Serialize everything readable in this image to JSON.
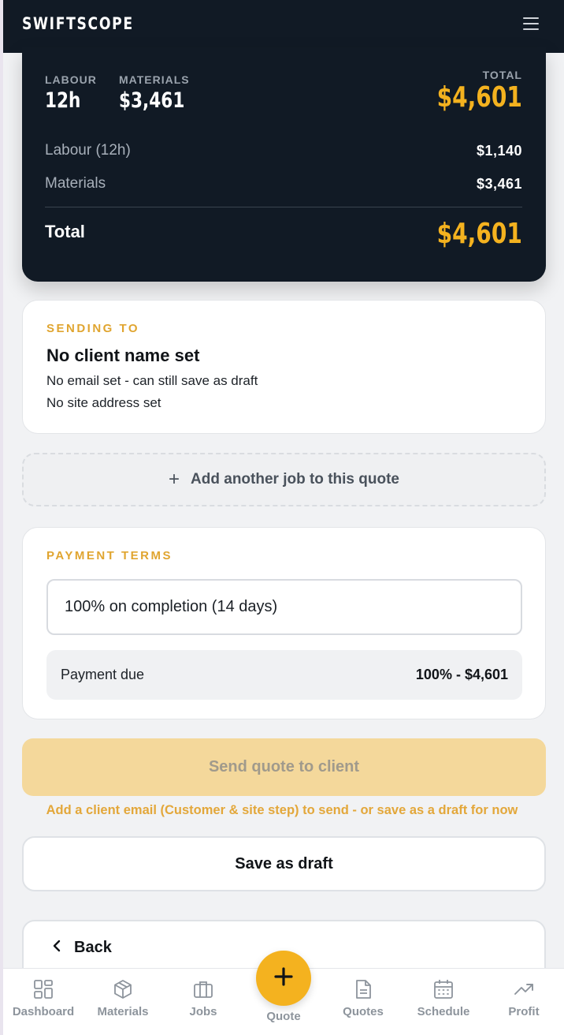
{
  "header": {
    "logo": "SWIFTSCOPE"
  },
  "summary": {
    "labour_label": "LABOUR",
    "labour_value": "12h",
    "materials_label": "MATERIALS",
    "materials_value": "$3,461",
    "total_label": "TOTAL",
    "total_value": "$4,601",
    "lines": [
      {
        "label": "Labour (12h)",
        "value": "$1,140"
      },
      {
        "label": "Materials",
        "value": "$3,461"
      }
    ],
    "grand_total_label": "Total",
    "grand_total_value": "$4,601"
  },
  "sending_to": {
    "section_label": "SENDING TO",
    "client_name": "No client name set",
    "email_line": "No email set - can still save as draft",
    "address_line": "No site address set"
  },
  "add_job": {
    "label": "Add another job to this quote"
  },
  "payment_terms": {
    "section_label": "PAYMENT TERMS",
    "selected_term": "100% on completion (14 days)",
    "due_label": "Payment due",
    "due_value": "100% - $4,601"
  },
  "actions": {
    "send_label": "Send quote to client",
    "hint": "Add a client email (Customer & site step) to send - or save as a draft for now",
    "draft_label": "Save as draft",
    "back_label": "Back"
  },
  "nav": {
    "items": [
      {
        "label": "Dashboard",
        "icon": "dashboard-icon"
      },
      {
        "label": "Materials",
        "icon": "box-icon"
      },
      {
        "label": "Jobs",
        "icon": "briefcase-icon"
      },
      {
        "label": "Quote",
        "icon": "plus-icon"
      },
      {
        "label": "Quotes",
        "icon": "document-icon"
      },
      {
        "label": "Schedule",
        "icon": "calendar-icon"
      },
      {
        "label": "Profit",
        "icon": "trend-up-icon"
      }
    ]
  },
  "colors": {
    "brand_dark": "#111a25",
    "accent": "#f4b21f",
    "section_label": "#e0a530",
    "send_disabled": "#f4d89b"
  }
}
